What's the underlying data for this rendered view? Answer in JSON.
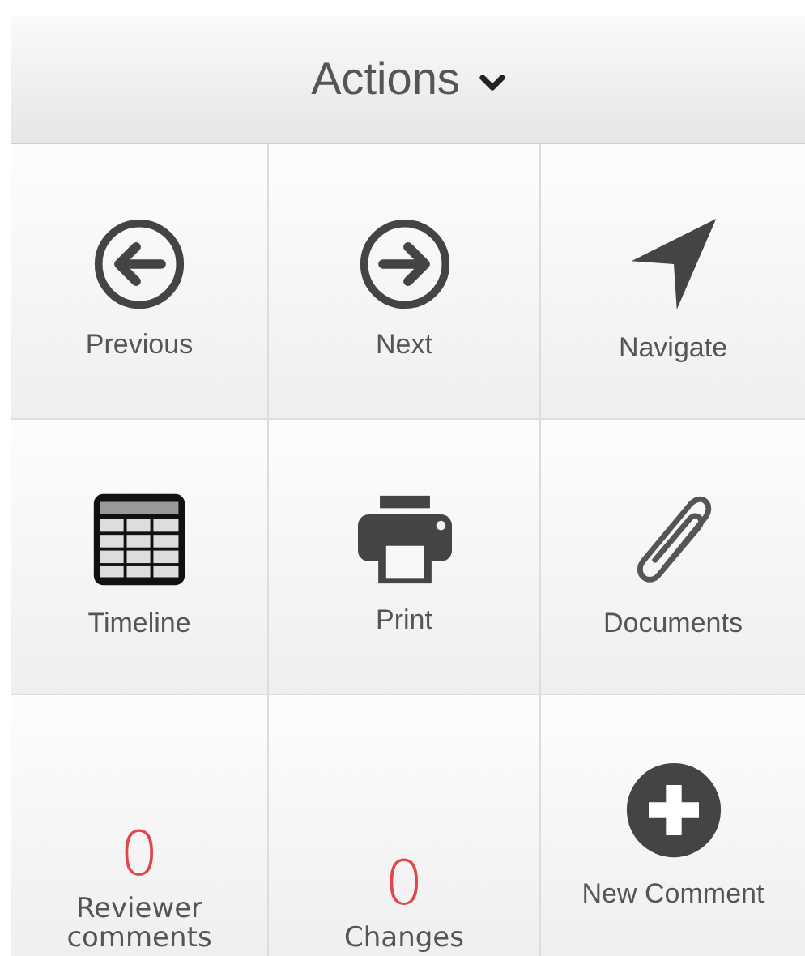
{
  "header": {
    "title": "Actions"
  },
  "tiles": [
    {
      "kind": "icon",
      "label": "Previous"
    },
    {
      "kind": "icon",
      "label": "Next"
    },
    {
      "kind": "icon",
      "label": "Navigate"
    },
    {
      "kind": "icon",
      "label": "Timeline"
    },
    {
      "kind": "icon",
      "label": "Print"
    },
    {
      "kind": "icon",
      "label": "Documents"
    },
    {
      "kind": "count",
      "count": "0",
      "label": "Reviewer comments"
    },
    {
      "kind": "count",
      "count": "0",
      "label": "Changes"
    },
    {
      "kind": "icon",
      "label": "New Comment"
    }
  ]
}
